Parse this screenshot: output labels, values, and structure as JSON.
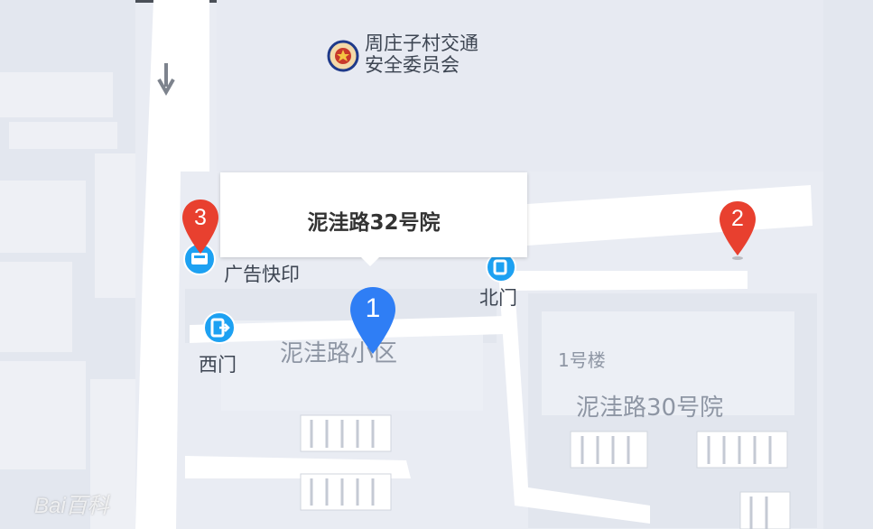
{
  "map": {
    "popup_title": "泥洼路32号院",
    "pois": {
      "committee_line1": "周庄子村交通",
      "committee_line2": "安全委员会",
      "ad_print": "广告快印",
      "west_gate": "西门",
      "north_gate": "北门"
    },
    "areas": {
      "niwa_community": "泥洼路小区",
      "building1": "1号楼",
      "niwa30": "泥洼路30号院"
    },
    "markers": [
      {
        "label": "1",
        "color": "#2f7ef5"
      },
      {
        "label": "2",
        "color": "#e8402f"
      },
      {
        "label": "3",
        "color": "#e8402f"
      }
    ],
    "watermark": "Bai百科",
    "colors": {
      "background": "#e9ecf3",
      "road": "#ffffff",
      "block": "#dde1ea",
      "poi_icon": "#1da1f2"
    }
  }
}
